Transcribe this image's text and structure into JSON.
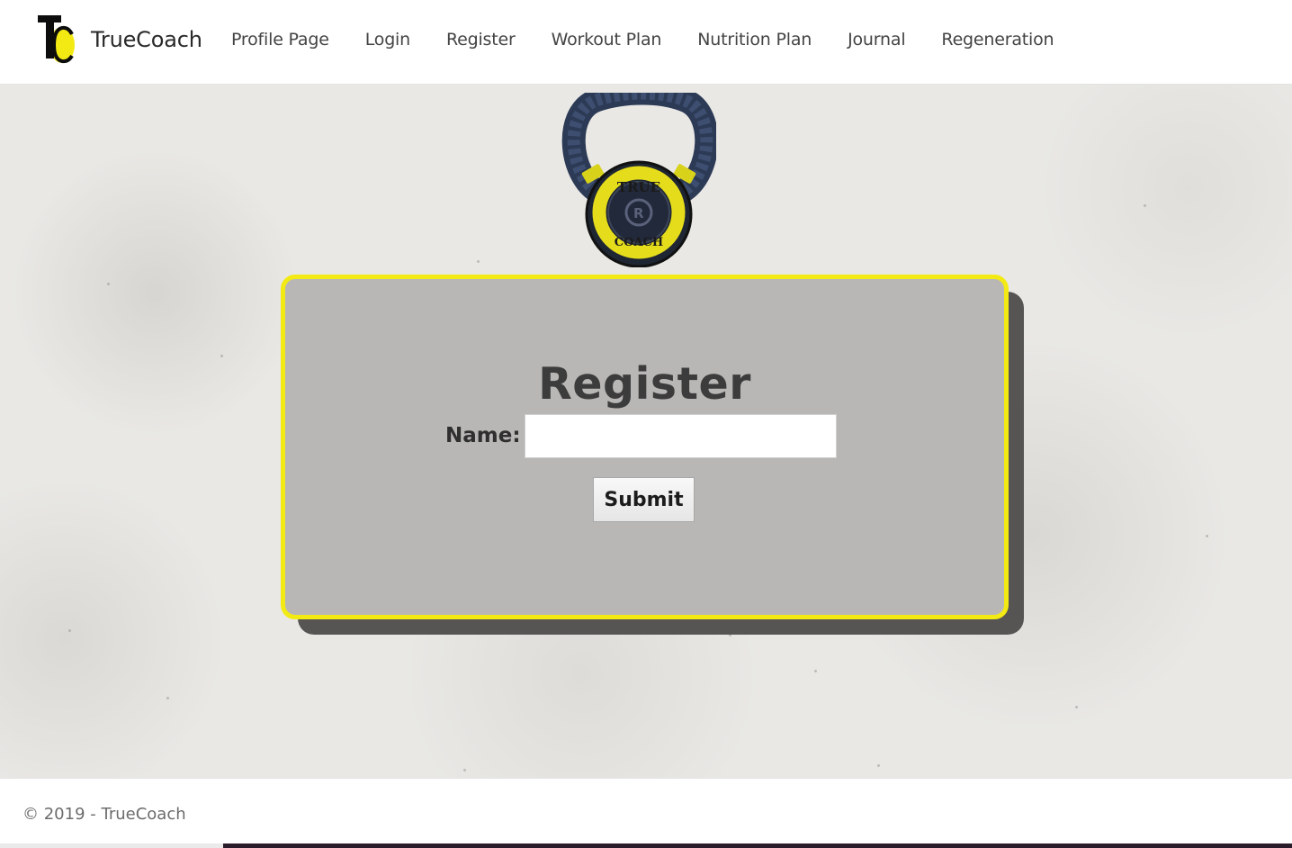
{
  "navbar": {
    "brand_name": "TrueCoach",
    "logo_icon": "truecoach-tc-logo-icon",
    "links": [
      {
        "label": "Profile Page"
      },
      {
        "label": "Login"
      },
      {
        "label": "Register"
      },
      {
        "label": "Workout Plan"
      },
      {
        "label": "Nutrition Plan"
      },
      {
        "label": "Journal"
      },
      {
        "label": "Regeneration"
      }
    ]
  },
  "hero": {
    "image_icon": "kettlebell-truecoach-icon",
    "image_text_top": "TRUE",
    "image_text_bottom": "COACH"
  },
  "register_form": {
    "title": "Register",
    "name_label": "Name:",
    "name_value": "",
    "name_placeholder": "",
    "submit_label": "Submit"
  },
  "footer": {
    "text": "© 2019 - TrueCoach"
  },
  "colors": {
    "accent_yellow": "#f3ea14",
    "card_background": "#b9b7b5",
    "card_shadow": "#575554",
    "page_background": "#e9e8e5"
  }
}
